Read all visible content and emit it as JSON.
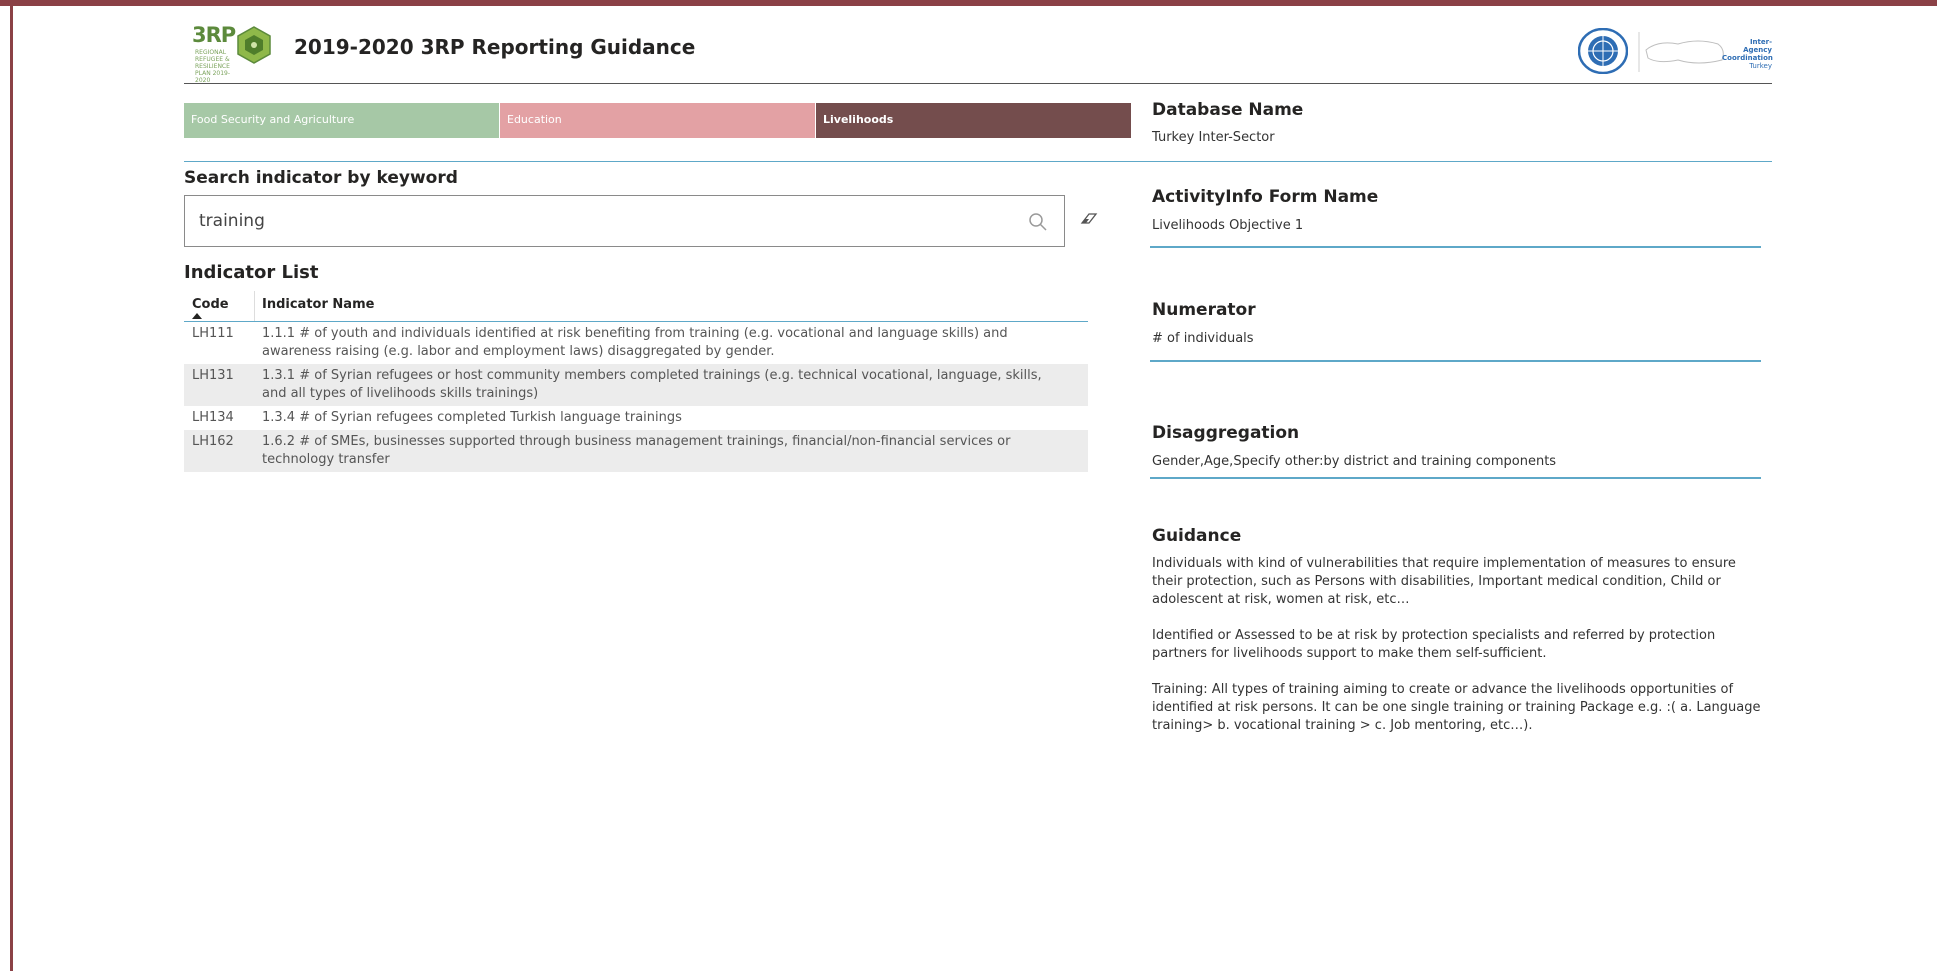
{
  "header": {
    "logo_text": "3RP",
    "logo_subtitle": "REGIONAL REFUGEE & RESILIENCE PLAN 2019-2020",
    "title": "2019-2020 3RP Reporting Guidance",
    "partner_logo_text": "Inter-Agency",
    "partner_logo_text2": "Coordination",
    "partner_logo_text3": "Turkey"
  },
  "tabs": [
    {
      "label": "Food Security and Agriculture",
      "color": "#a6c8a6",
      "selected": false
    },
    {
      "label": "Education",
      "color": "#e3a1a4",
      "selected": false
    },
    {
      "label": "Livelihoods",
      "color": "#744d4d",
      "selected": true
    }
  ],
  "search": {
    "label": "Search indicator by keyword",
    "value": "training",
    "placeholder": ""
  },
  "indicator_list": {
    "title": "Indicator List",
    "columns": [
      "Code",
      "Indicator Name"
    ],
    "rows": [
      {
        "code": "LH111",
        "name": "1.1.1 # of youth and individuals identified at risk benefiting from training (e.g. vocational and language skills) and awareness raising (e.g. labor and employment laws) disaggregated by gender."
      },
      {
        "code": "LH131",
        "name": "1.3.1 # of Syrian refugees or host community members completed trainings (e.g. technical vocational, language, skills, and all types of livelihoods skills trainings)"
      },
      {
        "code": "LH134",
        "name": "1.3.4 # of Syrian refugees completed Turkish language trainings"
      },
      {
        "code": "LH162",
        "name": "1.6.2 # of SMEs, businesses supported through business management trainings, financial/non-financial services or technology transfer"
      }
    ]
  },
  "details": {
    "database_label": "Database Name",
    "database_value": "Turkey Inter-Sector",
    "form_label": "ActivityInfo Form Name",
    "form_value": "Livelihoods Objective 1",
    "numerator_label": "Numerator",
    "numerator_value": "# of individuals",
    "disaggregation_label": "Disaggregation",
    "disaggregation_value": "Gender,Age,Specify other:by district and training components",
    "guidance_label": "Guidance",
    "guidance_paragraphs": [
      "Individuals with kind of vulnerabilities that require implementation of measures to ensure their protection, such as Persons with disabilities, Important medical condition, Child or adolescent at risk, women at risk, etc…",
      "Identified or Assessed to be at risk by protection specialists and referred by protection partners for livelihoods support to make them self-sufficient.",
      "Training: All types of training aiming to create or advance the livelihoods opportunities of identified at risk persons. It can be one single training or training Package e.g. :( a. Language training> b. vocational training > c. Job mentoring, etc…)."
    ]
  },
  "colors": {
    "frame": "#8b4146",
    "accent_rule": "#5ea8c8"
  }
}
